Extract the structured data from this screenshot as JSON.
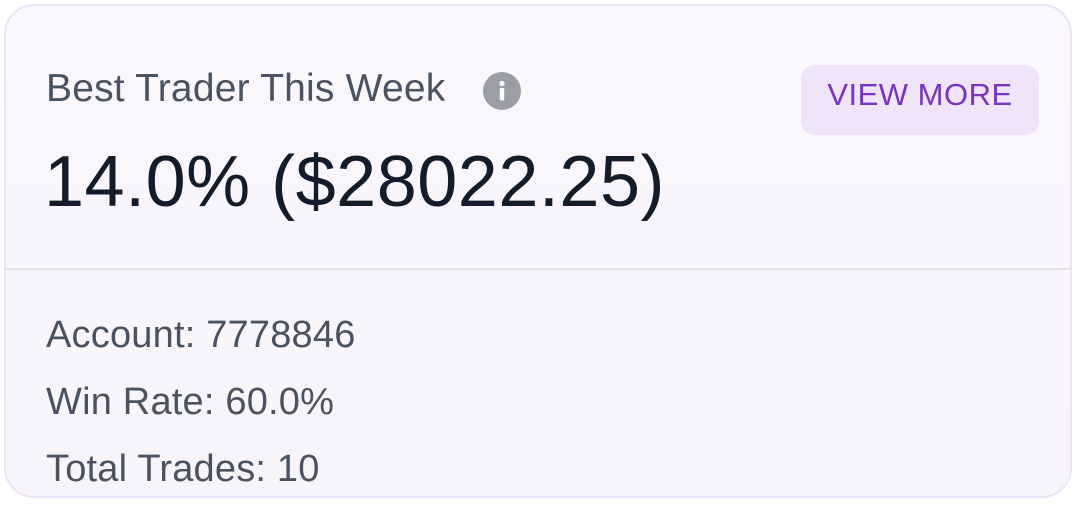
{
  "card": {
    "title": "Best Trader This Week",
    "info_icon": "info-icon",
    "view_more_label": "VIEW MORE",
    "headline": "14.0% ($28022.25)",
    "stats": [
      "Account: 7778846",
      "Win Rate: 60.0%",
      "Total Trades: 10"
    ]
  },
  "colors": {
    "accent": "#7a33c6",
    "accent_bg": "#eee5fa",
    "text_primary": "#141b2b",
    "text_secondary": "#4b5262",
    "icon_gray": "#9b9ea7"
  }
}
